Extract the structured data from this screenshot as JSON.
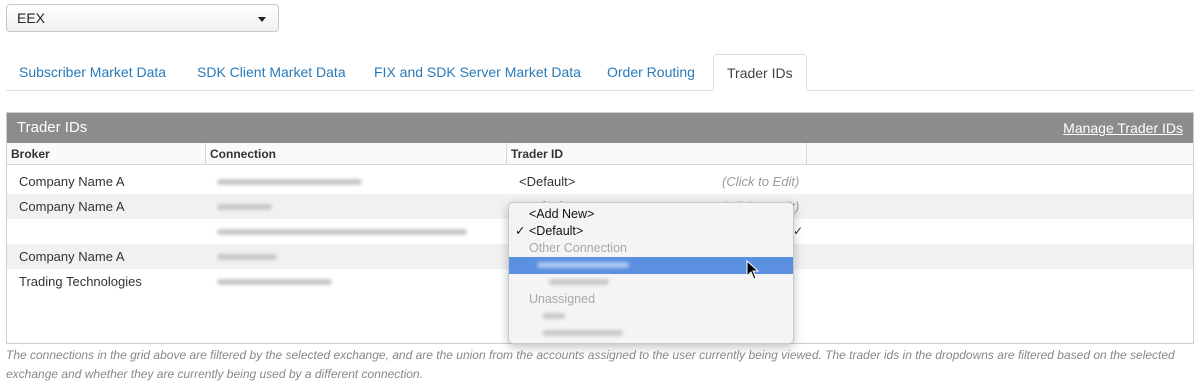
{
  "exchange_select": {
    "value": "EEX"
  },
  "tabs": [
    {
      "label": "Subscriber Market Data"
    },
    {
      "label": "SDK Client Market Data"
    },
    {
      "label": "FIX and SDK Server Market Data"
    },
    {
      "label": "Order Routing"
    },
    {
      "label": "Trader IDs"
    }
  ],
  "panel": {
    "title": "Trader IDs",
    "manage_link": "Manage Trader IDs",
    "columns": [
      "Broker",
      "Connection",
      "Trader ID"
    ]
  },
  "rows": [
    {
      "broker": "Company Name A",
      "trader_id": "<Default>",
      "hint": "(Click to Edit)"
    },
    {
      "broker": "Company Name A",
      "trader_id": "Default",
      "hint": "(Click to Edit)"
    },
    {
      "broker": "",
      "trader_id": "",
      "hint": ""
    },
    {
      "broker": "Company Name A",
      "trader_id": "",
      "hint": ""
    },
    {
      "broker": "Trading Technologies",
      "trader_id": "",
      "hint": ""
    }
  ],
  "dropdown": {
    "check_mark": "✓",
    "add_new": "<Add New>",
    "default": "<Default>",
    "other_connection": "Other Connection",
    "unassigned": "Unassigned"
  },
  "footnote": "The connections in the grid above are filtered by the selected exchange, and are the union from the accounts assigned to the user currently being viewed. The trader ids in the dropdowns are filtered based on the selected exchange and whether they are currently being used by a different connection."
}
